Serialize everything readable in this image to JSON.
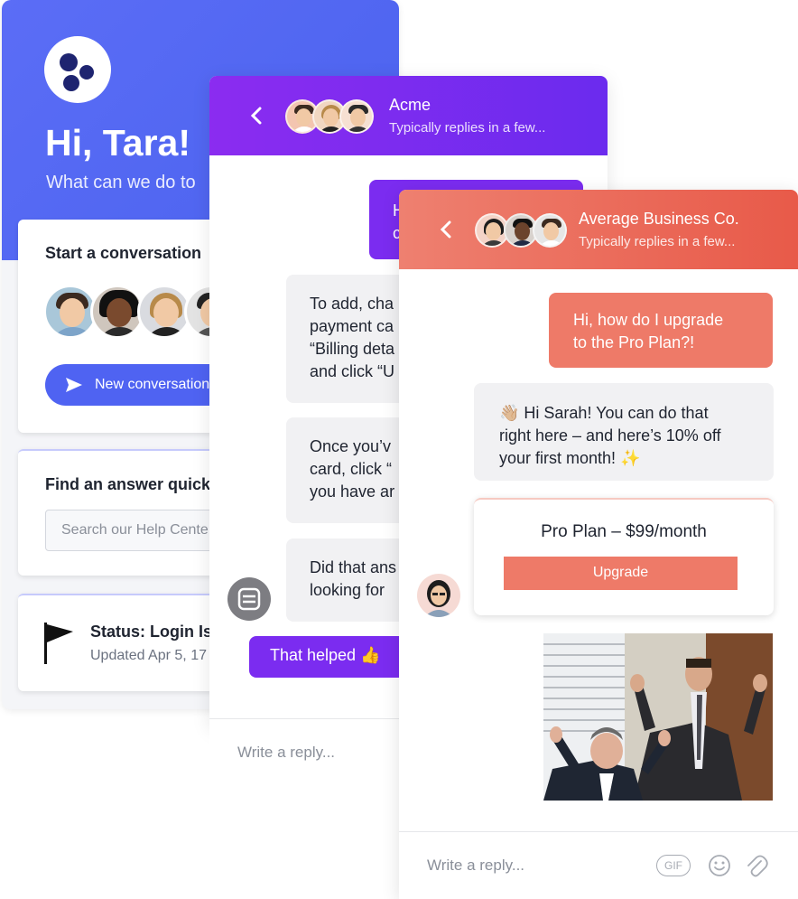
{
  "home": {
    "greeting": "Hi, Tara!",
    "subtitle": "What can we do to",
    "start_card": {
      "title": "Start a conversation",
      "button_label": "New conversation"
    },
    "find_card": {
      "title": "Find an answer quick",
      "search_placeholder": "Search our Help Cente"
    },
    "status_card": {
      "title": "Status: Login Is",
      "updated": "Updated Apr 5, 17"
    }
  },
  "acme": {
    "header": {
      "name": "Acme",
      "subtitle": "Typically replies in a few..."
    },
    "messages": [
      {
        "from": "user",
        "lines": [
          "H",
          "c"
        ]
      },
      {
        "from": "admin",
        "lines": [
          "To add, cha",
          "payment ca",
          "“Billing deta",
          "and click “U"
        ]
      },
      {
        "from": "admin",
        "lines": [
          "Once you’v",
          "card, click “",
          "you have ar"
        ]
      },
      {
        "from": "admin",
        "lines": [
          "Did that ans",
          "looking for"
        ]
      }
    ],
    "quick_reply": "That helped 👍",
    "reply_placeholder": "Write a reply..."
  },
  "abc": {
    "header": {
      "name": "Average Business Co.",
      "subtitle": "Typically replies in a few..."
    },
    "messages": [
      {
        "from": "user",
        "lines": [
          "Hi, how do I upgrade",
          "to the Pro Plan?!"
        ]
      },
      {
        "from": "admin",
        "lines": [
          "👋🏼 Hi Sarah! You can do that",
          "right here – and here’s 10% off",
          "your first month! ✨"
        ]
      }
    ],
    "plan_card": {
      "title": "Pro Plan – $99/month",
      "button_label": "Upgrade"
    },
    "reply_placeholder": "Write a reply...",
    "composer_icons": [
      "gif-icon",
      "emoji-icon",
      "attachment-icon"
    ],
    "gif_label": "GIF"
  },
  "colors": {
    "home_accent": "#4f63f2",
    "acme_accent": "#7b2cf0",
    "abc_accent": "#ee7a68"
  }
}
